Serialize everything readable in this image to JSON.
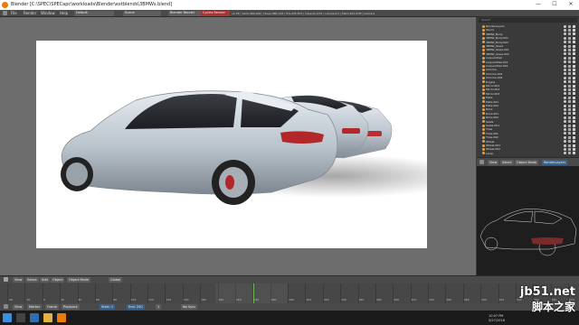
{
  "window": {
    "title": "Blender [C:\\SPEC\\SPECapc\\workloads\\Blender\\extblends\\3BMWs.blend]",
    "controls": [
      "—",
      "☐",
      "✕"
    ]
  },
  "info_header": {
    "menus": [
      "File",
      "Render",
      "Window",
      "Help"
    ],
    "layout_field": "Default",
    "scene_field": "Scene",
    "engine_field": "Blender Render",
    "render_field": "Cycles Render",
    "stats": "v2.78 | Verts:489,402 | Faces:480,128 | Tris:955,870 | Objects:0/31 | Lamps:0/1 | Mem:402.67M | Camera"
  },
  "outliner": {
    "search_label": "Search",
    "items": [
      "RenderLayers",
      "World",
      "3BMW_Body",
      "3BMW_Body.001",
      "3BMW_Body.002",
      "3BMW_Glass",
      "3BMW_Glass.001",
      "3BMW_Glass.002",
      "CarpaintSet",
      "CarpaintSet.001",
      "CarpaintSet.002",
      "Chrome",
      "Chrome.001",
      "Chrome.002",
      "Engine",
      "Mirror.001",
      "Mirror.002",
      "Mirror.003",
      "Plate",
      "Plate.001",
      "Plate.002",
      "Rims",
      "Rims.001",
      "Rims.002",
      "Seats",
      "Seats.001",
      "Tires",
      "Tires.001",
      "Tires.002",
      "Wheel",
      "Wheel.001",
      "Wheel.002",
      "Lamp"
    ]
  },
  "properties_header": {
    "view_label": "View",
    "select_label": "Select",
    "object_mode": "Object Mode",
    "shading": "Solid",
    "layer": "RenderLayers"
  },
  "viewport_header": {
    "view": "View",
    "select": "Select",
    "add": "Add",
    "object": "Object",
    "mode": "Object Mode",
    "pivot": "Global"
  },
  "timeline": {
    "ticks": [
      "-40",
      "-20",
      "0",
      "20",
      "40",
      "60",
      "80",
      "100",
      "120",
      "140",
      "160",
      "180",
      "200",
      "220",
      "240",
      "260",
      "280",
      "300",
      "320",
      "340",
      "360",
      "380",
      "400",
      "420",
      "440",
      "460",
      "480",
      "500",
      "520",
      "540",
      "560",
      "580",
      "600"
    ],
    "controls": [
      "View",
      "Marker",
      "Frame",
      "Playback"
    ],
    "start_label": "Start: 1",
    "end_label": "End: 250",
    "current": "1",
    "sync": "No Sync"
  },
  "taskbar": {
    "time": "5/27/2016",
    "clock": "10:07 PM"
  },
  "watermark": {
    "line1": "jb51.net",
    "line2": "脚本之家"
  },
  "colors": {
    "car_body": "#c6ced6",
    "taillight": "#b3262a",
    "accent": "#e87d0d"
  }
}
